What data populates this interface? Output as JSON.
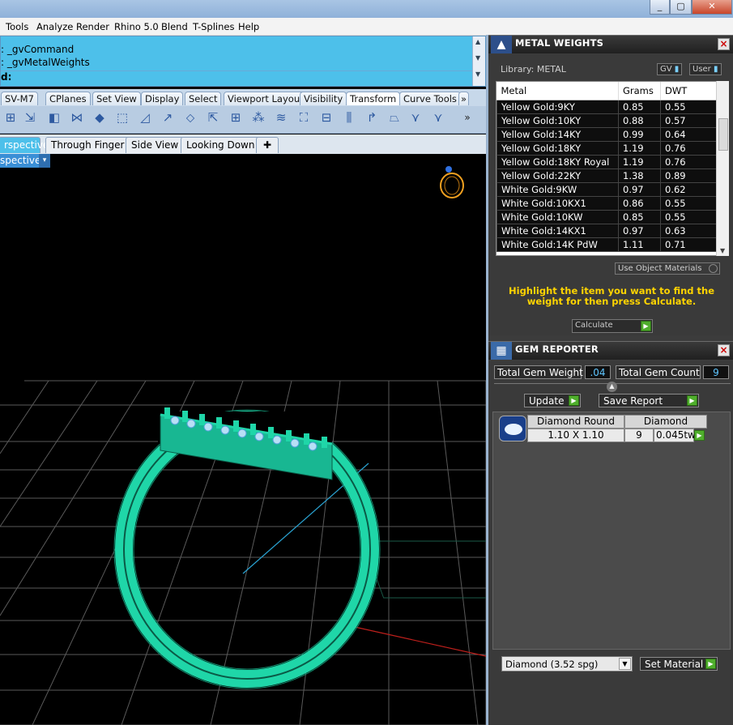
{
  "titlebar": {
    "min_label": "_",
    "max_label": "▢",
    "close_label": "✕"
  },
  "menu": {
    "items": [
      "Tools",
      "Analyze",
      "Render",
      "Rhino 5.0",
      "Blend",
      "T-Splines",
      "Help"
    ]
  },
  "command": {
    "line1": ": _gvCommand",
    "line2": ": _gvMetalWeights",
    "prompt": "d:"
  },
  "toolbar_tabs": [
    "SV-M7",
    "CPlanes",
    "Set View",
    "Display",
    "Select",
    "Viewport Layout",
    "Visibility",
    "Transform",
    "Curve Tools"
  ],
  "toolbar_active": "Transform",
  "toolbar_more": "»",
  "toolbar_overflow": "»",
  "viewport_tabs": [
    "rspective",
    "Through Finger",
    "Side View",
    "Looking Down"
  ],
  "viewport_add": "✚",
  "viewport": {
    "label": "spective",
    "dropdown": "▾"
  },
  "metal_panel": {
    "title": "METAL WEIGHTS",
    "library": "Library: METAL",
    "gv_label": "GV",
    "user_label": "User",
    "columns": [
      "Metal",
      "Grams",
      "DWT"
    ],
    "rows": [
      {
        "metal": "Yellow Gold:9KY",
        "grams": "0.85",
        "dwt": "0.55"
      },
      {
        "metal": "Yellow Gold:10KY",
        "grams": "0.88",
        "dwt": "0.57"
      },
      {
        "metal": "Yellow Gold:14KY",
        "grams": "0.99",
        "dwt": "0.64"
      },
      {
        "metal": "Yellow Gold:18KY",
        "grams": "1.19",
        "dwt": "0.76"
      },
      {
        "metal": "Yellow Gold:18KY Royal",
        "grams": "1.19",
        "dwt": "0.76"
      },
      {
        "metal": "Yellow Gold:22KY",
        "grams": "1.38",
        "dwt": "0.89"
      },
      {
        "metal": "White Gold:9KW",
        "grams": "0.97",
        "dwt": "0.62"
      },
      {
        "metal": "White Gold:10KX1",
        "grams": "0.86",
        "dwt": "0.55"
      },
      {
        "metal": "White Gold:10KW",
        "grams": "0.85",
        "dwt": "0.55"
      },
      {
        "metal": "White Gold:14KX1",
        "grams": "0.97",
        "dwt": "0.63"
      },
      {
        "metal": "White Gold:14K PdW",
        "grams": "1.11",
        "dwt": "0.71"
      }
    ],
    "use_object_materials": "Use Object Materials",
    "instruction": "Highlight the item you want to find the weight for then press Calculate.",
    "calculate_label": "Calculate"
  },
  "gem_panel": {
    "title": "GEM REPORTER",
    "total_weight_label": "Total Gem Weight",
    "total_weight_value": ".04",
    "total_count_label": "Total Gem Count",
    "total_count_value": "9",
    "update_label": "Update",
    "save_report_label": "Save Report",
    "gem_headers": [
      "Diamond Round",
      "Diamond"
    ],
    "gem_row": {
      "size": "1.10 X 1.10",
      "count": "9",
      "weight": "0.045tw"
    },
    "material_select": "Diamond     (3.52 spg)",
    "set_material_label": "Set Material"
  },
  "colors": {
    "ring": "#1fd6a8",
    "grid": "#6f6f6f",
    "accent": "#4dc0ea",
    "green_button": "#4fae2c"
  }
}
